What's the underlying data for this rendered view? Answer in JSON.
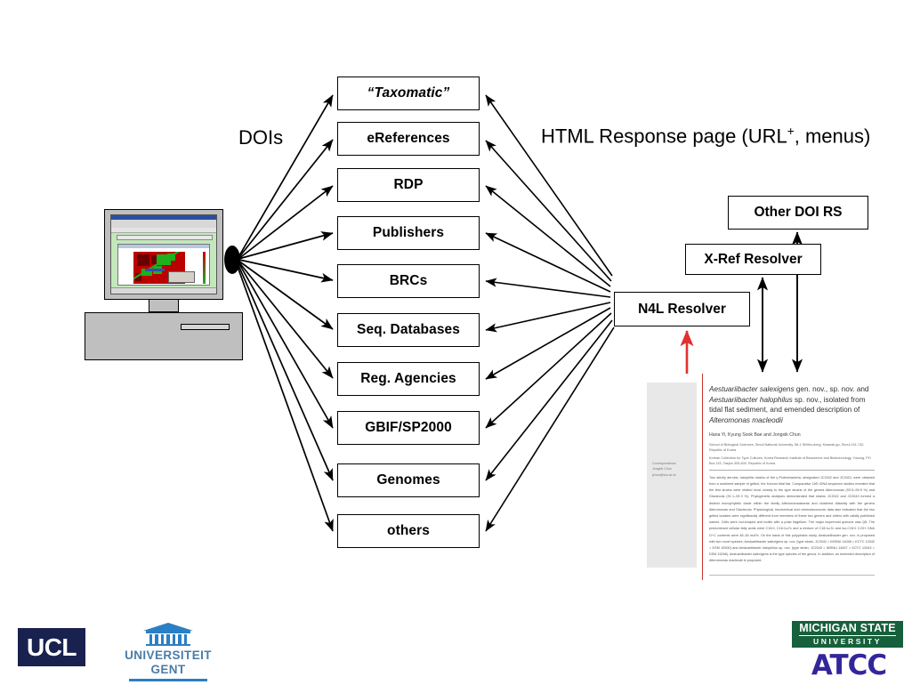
{
  "labels": {
    "dois": "DOIs",
    "html_response_pre": "HTML Response page (URL",
    "html_response_sup": "+",
    "html_response_post": ", menus)"
  },
  "services": [
    {
      "name": "taxomatic",
      "label": "“Taxomatic”",
      "style": "quoted"
    },
    {
      "name": "ereferences",
      "label": "eReferences",
      "style": "normal"
    },
    {
      "name": "rdp",
      "label": "RDP",
      "style": "normal"
    },
    {
      "name": "publishers",
      "label": "Publishers",
      "style": "normal"
    },
    {
      "name": "brcs",
      "label": "BRCs",
      "style": "normal"
    },
    {
      "name": "seq-databases",
      "label": "Seq. Databases",
      "style": "normal"
    },
    {
      "name": "reg-agencies",
      "label": "Reg. Agencies",
      "style": "normal"
    },
    {
      "name": "gbif-sp2000",
      "label": "GBIF/SP2000",
      "style": "normal"
    },
    {
      "name": "genomes",
      "label": "Genomes",
      "style": "normal"
    },
    {
      "name": "others",
      "label": "others",
      "style": "normal"
    }
  ],
  "resolvers": {
    "other_doi_rs": "Other DOI RS",
    "xref": "X-Ref Resolver",
    "n4l": "N4L Resolver"
  },
  "paper": {
    "title_line1_italic": "Aestuariibacter salexigens",
    "title_line1_upright": " gen. nov., sp. nov. and",
    "title_line2_italic": "Aestuariibacter halophilus",
    "title_line2_upright": " sp. nov., isolated from",
    "title_line3": "tidal flat sediment, and emended description of",
    "title_line4_italic": "Alteromonas macleodii",
    "authors": "Hana Yi, Kyung Sook Bae and Jongsik Chun",
    "affiliation1": "School of Biological Sciences, Seoul National University, 56-1 Shillim-dong, Kwanak-gu, Seoul 151-742, Republic of Korea",
    "affiliation2": "Korean Collection for Type Cultures, Korea Research Institute of Bioscience and Biotechnology, Yusung, PO Box 115, Taejon 305-600, Republic of Korea",
    "correspondence_label": "Correspondence",
    "correspondence_name": "Jongsik Chun",
    "correspondence_email": "jchun@snu.ac.kr",
    "abstract": "Two strictly aerobic, halophilic strains of the γ-Proteobacteria, designated JC2042 and JC2043, were obtained from a sediment sample of getbol, the Korean tidal flat. Comparative 16S rDNA sequence studies revealed that the test strains were related most closely to the type strains of the genera Alteromonas (93·5–95·5 %) and Glaciecola (91·1–93·3 %). Phylogenetic analyses demonstrated that strains JC2042 and JC2043 formed a distinct monophyletic clade within the family Alteromonadaceae and clustered distantly with the genera Alteromonas and Glaciecola. Physiological, biochemical and chemotaxonomic data also indicated that the two getbol isolates were significantly different from members of these two genera and others with validly published names. Cells were rod-shaped and motile with a polar flagellum. The major isoprenoid quinone was Q8. The predominant cellular fatty acids were C16:0, C16:1ω7c and a mixture of C18:1ω7c and iso-C15:0 2-OH. DNA G+C contents were 48–54 mol%. On the basis of this polyphasic study, Aestuariibacter gen. nov. is proposed with two novel species, Aestuariibacter salexigens sp. nov. (type strain, JC2042 = IMSNU 14006 = KCTC 12042 = DSM 15300) and Aestuariibacter halophilus sp. nov. (type strain, JC2043 = IMSNU 14007 = KCTC 12043 = DSM 15266). Aestuariibacter salexigens is the type species of the genus. In addition, an emended description of Alteromonas macleodii is proposed."
  },
  "logos": {
    "ucl": "UCL",
    "ugent_line1": "UNIVERSITEIT",
    "ugent_line2": "GENT",
    "msu_line1": "MICHIGAN STATE",
    "msu_line2": "UNIVERSITY",
    "atcc": "ATCC"
  },
  "colors": {
    "arrow_black": "#000000",
    "arrow_red": "#e03030",
    "ucl_navy": "#19214f",
    "ugent_blue": "#2b7fc4",
    "msu_green": "#16603b",
    "atcc_blue": "#33269b",
    "screen_green": "#c3e8bb",
    "heatmap_red": "#bb0000",
    "heatmap_green": "#1eb01e"
  }
}
